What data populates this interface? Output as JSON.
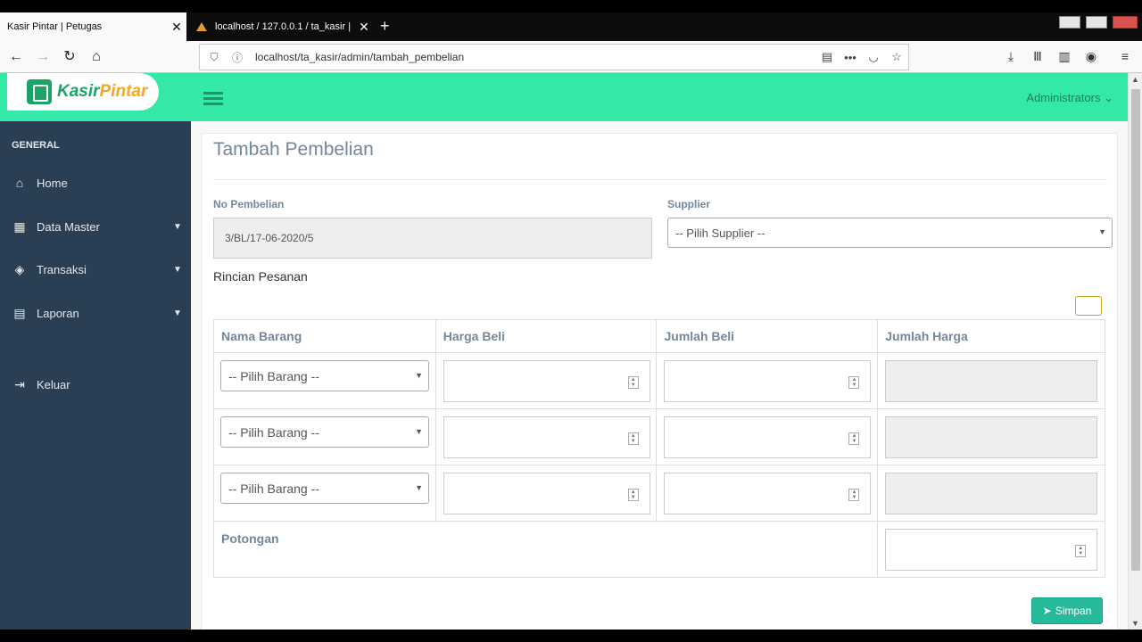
{
  "browser": {
    "tabs": [
      {
        "title": "Kasir Pintar | Petugas",
        "close": "✕"
      },
      {
        "title": "localhost / 127.0.0.1 / ta_kasir |",
        "close": "✕"
      }
    ],
    "new_tab": "+",
    "url": "localhost/ta_kasir/admin/tambah_pembelian"
  },
  "app": {
    "logo_prefix": "Kasir",
    "logo_suffix": "Pintar",
    "user_menu": "Administrators ⌄"
  },
  "sidebar": {
    "section": "GENERAL",
    "items": [
      {
        "label": "Home",
        "icon": "home-icon",
        "glyph": "⌂"
      },
      {
        "label": "Data Master",
        "icon": "table-icon",
        "glyph": "▦",
        "chevron": "▼"
      },
      {
        "label": "Transaksi",
        "icon": "tag-icon",
        "glyph": "◈",
        "chevron": "▼"
      },
      {
        "label": "Laporan",
        "icon": "print-icon",
        "glyph": "▤",
        "chevron": "▼"
      },
      {
        "label": "Keluar",
        "icon": "sign-out-icon",
        "glyph": "⇥"
      }
    ]
  },
  "page": {
    "title": "Tambah Pembelian",
    "no_pembelian_label": "No Pembelian",
    "no_pembelian_value": "3/BL/17-06-2020/5",
    "supplier_label": "Supplier",
    "supplier_value": "-- Pilih Supplier --",
    "rincian_label": "Rincian Pesanan",
    "table": {
      "headers": [
        "Nama Barang",
        "Harga Beli",
        "Jumlah Beli",
        "Jumlah Harga"
      ],
      "rows": [
        {
          "barang": "-- Pilih Barang --"
        },
        {
          "barang": "-- Pilih Barang --"
        },
        {
          "barang": "-- Pilih Barang --"
        }
      ],
      "potongan_label": "Potongan"
    },
    "save_button": "Simpan"
  }
}
